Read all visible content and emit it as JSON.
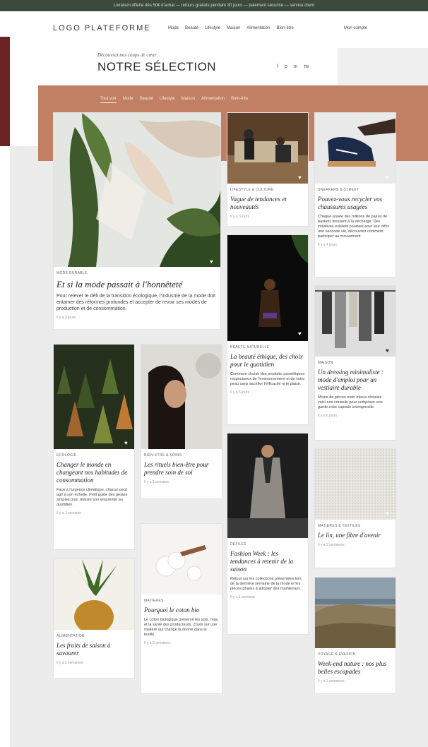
{
  "topbar": "Livraison offerte dès 50€ d'achat — retours gratuits pendant 30 jours — paiement sécurisé — service client",
  "header": {
    "logo": "LOGO PLATEFORME",
    "nav": [
      "Mode",
      "Beauté",
      "Lifestyle",
      "Maison",
      "Alimentation",
      "Bien-être"
    ],
    "nav_right": "Mon compte"
  },
  "page": {
    "kicker": "Découvrez nos coups de cœur",
    "title": "NOTRE SÉLECTION",
    "socials": [
      "f",
      "p",
      "in",
      "tw"
    ]
  },
  "filters": [
    "Tout voir",
    "Mode",
    "Beauté",
    "Lifestyle",
    "Maison",
    "Alimentation",
    "Bien-être"
  ],
  "colors": {
    "topbar": "#3c4a3e",
    "accent_band": "#c17f63",
    "side_accent": "#6b2423",
    "page_bg": "#ececec"
  },
  "cards": {
    "c1": {
      "category": "MODE DURABLE",
      "title": "Et si la mode passait à l'honnêteté",
      "excerpt": "Pour relever le défi de la transition écologique, l'industrie de la mode doit entamer des réformes profondes et accepter de revoir ses modes de production et de consommation.",
      "date": "Il y a 2 jours",
      "heart": "♥"
    },
    "c2": {
      "category": "LIFESTYLE & CULTURE",
      "title": "Vague de tendances et nouveautés",
      "date": "Il y a 3 jours",
      "heart": "♥"
    },
    "c3": {
      "category": "SNEAKERS & STREET",
      "title": "Pouvez-vous recycler vos chaussures usagées",
      "excerpt": "Chaque année des millions de paires de baskets finissent à la décharge. Des initiatives existent pourtant pour leur offrir une seconde vie, découvrez comment participer au mouvement.",
      "date": "Il y a 4 jours",
      "heart": "♥"
    },
    "c4": {
      "category": "BEAUTÉ NATURELLE",
      "title": "La beauté éthique, des choix pour le quotidien",
      "excerpt": "Comment choisir des produits cosmétiques respectueux de l'environnement et de votre peau sans sacrifier l'efficacité ni le plaisir.",
      "date": "Il y a 5 jours",
      "heart": "♥"
    },
    "c5": {
      "category": "MAISON",
      "title": "Un dressing minimaliste : mode d'emploi pour un vestiaire durable",
      "excerpt": "Moins de pièces mais mieux choisies : voici nos conseils pour composer une garde-robe capsule intemporelle.",
      "date": "Il y a 6 jours",
      "heart": "♥"
    },
    "c6": {
      "category": "ÉCOLOGIE",
      "title": "Changer le monde en changeant nos habitudes de consommation",
      "excerpt": "Face à l'urgence climatique, chacun peut agir à son échelle. Petit guide des gestes simples pour réduire son empreinte au quotidien.",
      "date": "Il y a 1 semaine",
      "heart": "♥"
    },
    "c7": {
      "category": "BIEN-ÊTRE & SOINS",
      "title": "Les rituels bien-être pour prendre soin de soi",
      "date": "Il y a 1 semaine",
      "heart": "♥"
    },
    "c8": {
      "category": "DÉFILÉS",
      "title": "Fashion Week : les tendances à retenir de la saison",
      "excerpt": "Retour sur les collections présentées lors de la dernière semaine de la mode et les pièces phares à adopter dès maintenant.",
      "date": "Il y a 1 semaine",
      "heart": "♥"
    },
    "c9": {
      "category": "MATIÈRES & TEXTILES",
      "title": "Le lin, une fibre d'avenir",
      "date": "Il y a 2 semaines",
      "heart": "♥"
    },
    "c10": {
      "category": "ALIMENTATION",
      "title": "Les fruits de saison à savourer",
      "date": "Il y a 2 semaines"
    },
    "c11": {
      "category": "MATIÈRES",
      "title": "Pourquoi le coton bio",
      "excerpt": "Le coton biologique préserve les sols, l'eau et la santé des producteurs. Zoom sur une matière qui change la donne dans le textile.",
      "date": "Il y a 2 semaines"
    },
    "c12": {
      "category": "VOYAGE & ÉVASION",
      "title": "Week-end nature : nos plus belles escapades",
      "date": "Il y a 3 semaines"
    }
  }
}
